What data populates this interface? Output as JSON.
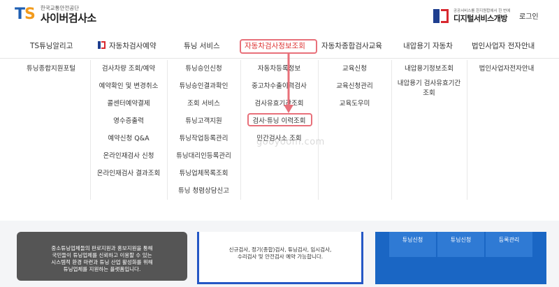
{
  "header": {
    "logo_mark_t": "T",
    "logo_mark_s": "S",
    "logo_sub": "한국교통안전공단",
    "logo_main": "사이버검사소",
    "dgov_sub": "공공서비스를 한지원합에서 한 번에",
    "dgov_main": "디지털서비스개방",
    "login": "로그인"
  },
  "nav": [
    {
      "label": "TS튜닝알리고"
    },
    {
      "label": "자동차검사예약"
    },
    {
      "label": "튜닝 서비스"
    },
    {
      "label": "자동차검사정보조회"
    },
    {
      "label": "자동차종합검사교육"
    },
    {
      "label": "내압용기 자동차"
    },
    {
      "label": "법인사업자 전자안내"
    }
  ],
  "menu": {
    "col1": [
      "튜닝종합지원포털"
    ],
    "col2": [
      "검사차량 조회/예약",
      "예약확인 및 변경취소",
      "콜센터예약결제",
      "영수증출력",
      "예약신청 Q&A",
      "온라인재검사 신청",
      "온라인재검사 결과조회"
    ],
    "col3": [
      "튜닝승인신청",
      "튜닝승인결과확인",
      "조회 서비스",
      "튜닝고객지원",
      "튜닝작업등록관리",
      "튜닝대리인등록관리",
      "튜닝업체목록조회",
      "튜닝 청렴상담신고"
    ],
    "col4": [
      "자동차등록정보",
      "중고차수출이력검사",
      "검사유효기간조회",
      "검사·튜닝 이력조회",
      "민간검사소 조회"
    ],
    "col5": [
      "교육신청",
      "교육신청관리",
      "교육도우미"
    ],
    "col6": [
      "내압용기정보조회",
      "내압용기 검사유효기간 조회"
    ],
    "col7": [
      "법인사업자전자안내"
    ]
  },
  "watermark": "gooyoom.com",
  "bottom": {
    "card1_lines": [
      "중소튜닝업체들의 판로지원과 홍보지원을 통해",
      "국민들이 튜닝업체를 신뢰하고 이용할 수 있는",
      "시스템적 환경 마련과 튜닝 산업 활성화를 위해",
      "튜닝업체를 지원하는 플랫폼입니다."
    ],
    "card2_lines": [
      "신규검사, 정기(종합)검사, 튜닝검사, 임시검사,",
      "수리검사 및 안전검사 예약 가능합니다."
    ],
    "tiles": [
      "튜닝신청",
      "튜닝신청",
      "등록관리"
    ]
  },
  "colors": {
    "highlight": "#e8707a",
    "brand_blue": "#1f5fb3",
    "brand_orange": "#f29b1d"
  }
}
